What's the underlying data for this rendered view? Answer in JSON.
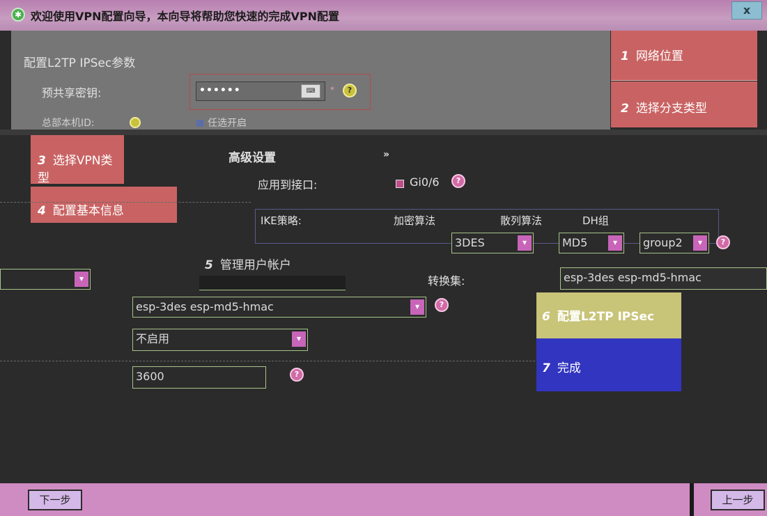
{
  "window": {
    "title": "欢迎使用VPN配置向导，本向导将帮助您快速的完成VPN配置",
    "close_label": "x"
  },
  "section": {
    "title": "配置L2TP IPSec参数",
    "psk_label": "预共享密钥:",
    "psk_value": "••••••",
    "local_id_label": "总部本机ID:",
    "optional_label": "任选开启"
  },
  "advanced": {
    "title": "高级设置",
    "apply_label": "应用到接口:",
    "interface": "Gi0/6",
    "ike_header": {
      "policy": "IKE策略:",
      "encryption": "加密算法",
      "hash": "散列算法",
      "dh": "DH组"
    },
    "ike_values": {
      "encryption": "3DES",
      "hash": "MD5",
      "dh": "group2"
    },
    "transform_label": "转换集:",
    "transform_right": "esp-3des esp-md5-hmac",
    "transform_main": "esp-3des esp-md5-hmac",
    "pfs": "不启用",
    "lifetime": "3600"
  },
  "steps": [
    {
      "num": "1",
      "label": "网络位置"
    },
    {
      "num": "2",
      "label": "选择分支类型"
    },
    {
      "num": "3",
      "label": "选择VPN类型"
    },
    {
      "num": "4",
      "label": "配置基本信息"
    },
    {
      "num": "5",
      "label": "管理用户帐户"
    },
    {
      "num": "6",
      "label": "配置L2TP IPSec"
    },
    {
      "num": "7",
      "label": "完成"
    }
  ],
  "footer": {
    "next": "下一步",
    "prev": "上一步"
  },
  "colors": {
    "steps_bg": "#c96363",
    "active_step_bg": "#c8c478",
    "finish_step_bg": "#3135c0",
    "footer_bg": "#cf8cc3"
  }
}
